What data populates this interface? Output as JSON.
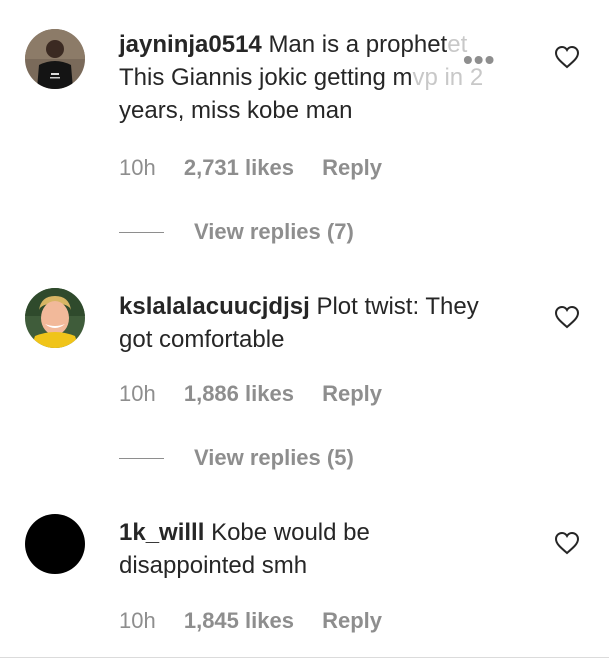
{
  "comments": [
    {
      "username": "jayninja0514",
      "text_visible": "Man is a prophet",
      "text_faded": ". This Giannis jokic getting mvp in 2",
      "text_rest": "years, miss kobe man",
      "line2_prefix": "This Giannis jokic getting m",
      "line2_faded": "vp in 2",
      "time": "10h",
      "likes": "2,731 likes",
      "reply": "Reply",
      "view_replies": "View replies (7)",
      "more_label": "•••",
      "avatar_icon": "user-avatar-black-shirt"
    },
    {
      "username": "kslalalacuucjdjsj",
      "text": "Plot twist: They got comfortable",
      "time": "10h",
      "likes": "1,886 likes",
      "reply": "Reply",
      "view_replies": "View replies (5)",
      "avatar_icon": "user-avatar-blonde"
    },
    {
      "username": "1k_willl",
      "text": "Kobe would be disappointed smh",
      "time": "10h",
      "likes": "1,845 likes",
      "reply": "Reply",
      "avatar_icon": "user-avatar-black"
    }
  ],
  "icons": {
    "like": "heart-outline-icon"
  },
  "colors": {
    "text": "#262626",
    "secondary": "#8e8e8e",
    "divider": "#dbdbdb"
  }
}
